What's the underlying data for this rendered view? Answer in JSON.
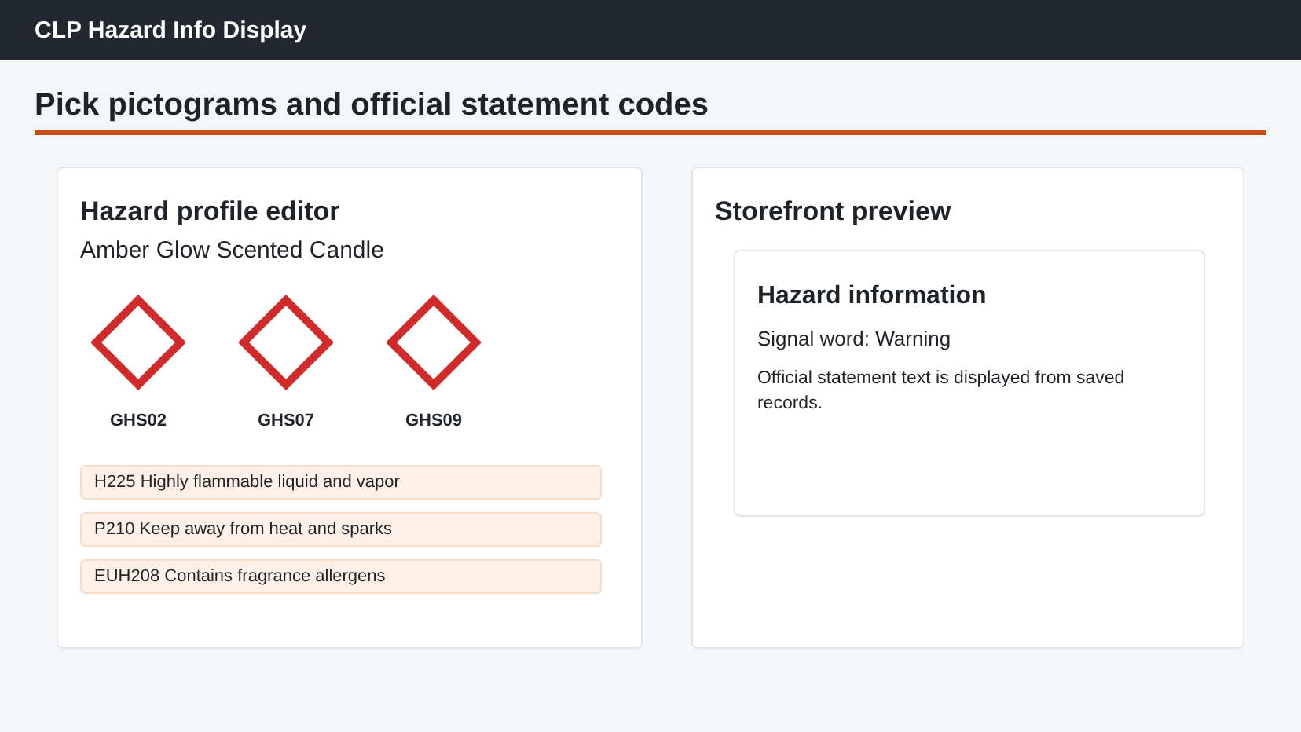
{
  "app_bar": {
    "title": "CLP Hazard Info Display"
  },
  "page_title": "Pick pictograms and official statement codes",
  "editor": {
    "title": "Hazard profile editor",
    "product": "Amber Glow Scented Candle",
    "pictograms": [
      {
        "code": "GHS02"
      },
      {
        "code": "GHS07"
      },
      {
        "code": "GHS09"
      }
    ],
    "statements": [
      "H225 Highly flammable liquid and vapor",
      "P210 Keep away from heat and sparks",
      "EUH208 Contains fragrance allergens"
    ]
  },
  "preview": {
    "title": "Storefront preview",
    "card": {
      "title": "Hazard information",
      "signal_word": "Signal word: Warning",
      "note": "Official statement text is displayed from saved records."
    }
  }
}
